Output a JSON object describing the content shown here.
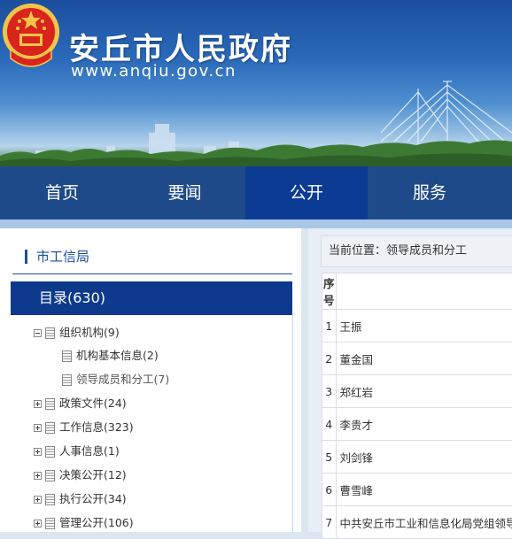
{
  "site": {
    "title": "安丘市人民政府",
    "url": "www.anqiu.gov.cn"
  },
  "nav": {
    "items": [
      {
        "label": "首页"
      },
      {
        "label": "要闻"
      },
      {
        "label": "公开"
      },
      {
        "label": "服务"
      }
    ],
    "active": "公开"
  },
  "sidebar": {
    "title": "市工信局",
    "directory_label": "目录(630)",
    "tree": [
      {
        "label": "组织机构(9)",
        "state": "expanded"
      },
      {
        "label": "机构基本信息(2)",
        "state": "child"
      },
      {
        "label": "领导成员和分工(7)",
        "state": "child-selected"
      },
      {
        "label": "政策文件(24)",
        "state": "collapsed"
      },
      {
        "label": "工作信息(323)",
        "state": "collapsed"
      },
      {
        "label": "人事信息(1)",
        "state": "collapsed"
      },
      {
        "label": "决策公开(12)",
        "state": "collapsed"
      },
      {
        "label": "执行公开(34)",
        "state": "collapsed"
      },
      {
        "label": "管理公开(106)",
        "state": "collapsed"
      }
    ]
  },
  "main": {
    "breadcrumb": "当前位置：领导成员和分工",
    "table": {
      "header": "序号",
      "rows": [
        {
          "no": "1",
          "name": "王振"
        },
        {
          "no": "2",
          "name": "董金国"
        },
        {
          "no": "3",
          "name": "郑红岩"
        },
        {
          "no": "4",
          "name": "李贵才"
        },
        {
          "no": "5",
          "name": "刘剑锋"
        },
        {
          "no": "6",
          "name": "曹雪峰"
        },
        {
          "no": "7",
          "name": "中共安丘市工业和信息化局党组领导"
        }
      ]
    }
  },
  "colors": {
    "nav_bg": "#1f4a8a",
    "nav_active": "#0c3b94",
    "accent": "#1c4e9a"
  }
}
